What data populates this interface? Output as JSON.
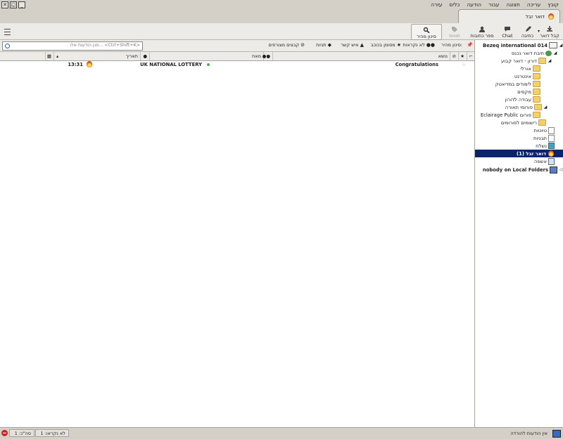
{
  "menubar": [
    "קובץ",
    "עריכה",
    "תצוגה",
    "עבור",
    "הודעה",
    "כלים",
    "עזרה"
  ],
  "tab": {
    "label": "דואר זבל"
  },
  "toolbar": {
    "get_mail": "קבל דואר",
    "write": "כתיבה",
    "chat": "Chat",
    "address_book": "ספר כתובות",
    "tags": "תוויות",
    "quick_filter": "סינון מהיר"
  },
  "filterbar": {
    "quick_filter_label": "סינון מהיר:",
    "unread": "לא נקראות",
    "starred": "מסומן בכוכב",
    "contact": "איש קשר",
    "tags": "תגיות",
    "attachments": "קבצים מצורפים",
    "search_placeholder": "סנן הודעות אלו... <Ctrl+Shift+K>"
  },
  "columns": {
    "subject": "נושא",
    "from": "מאת",
    "date": "תאריך"
  },
  "messages": [
    {
      "subject": "Congratulations",
      "from": "UK NATIONAL LOTTERY",
      "date": "13:31"
    }
  ],
  "folders": {
    "account1": "Bezeq international 014",
    "inbox": "תיבת דואר נכנס",
    "doron": "דורון - דואר קבוע",
    "orli": "אורלי",
    "internet": "אינטרנט",
    "studies": "לימודים במדיאטק",
    "maxim": "מקסים",
    "work": "עבודה לדורון",
    "forums": "פורומי תאורה",
    "eclairage": "Eclairage Public פורום",
    "registrations": "רישומים לפורומים",
    "drafts": "טיוטות",
    "templates": "תבניות",
    "sent": "נשלח",
    "junk": "דואר זבל (1)",
    "trash": "אשפה",
    "account2": "nobody on Local Folders"
  },
  "status": {
    "left_msg": "אין הודעות להורדה",
    "unread": "לא נקראו: 1",
    "total": "סה\"כ: 1"
  }
}
